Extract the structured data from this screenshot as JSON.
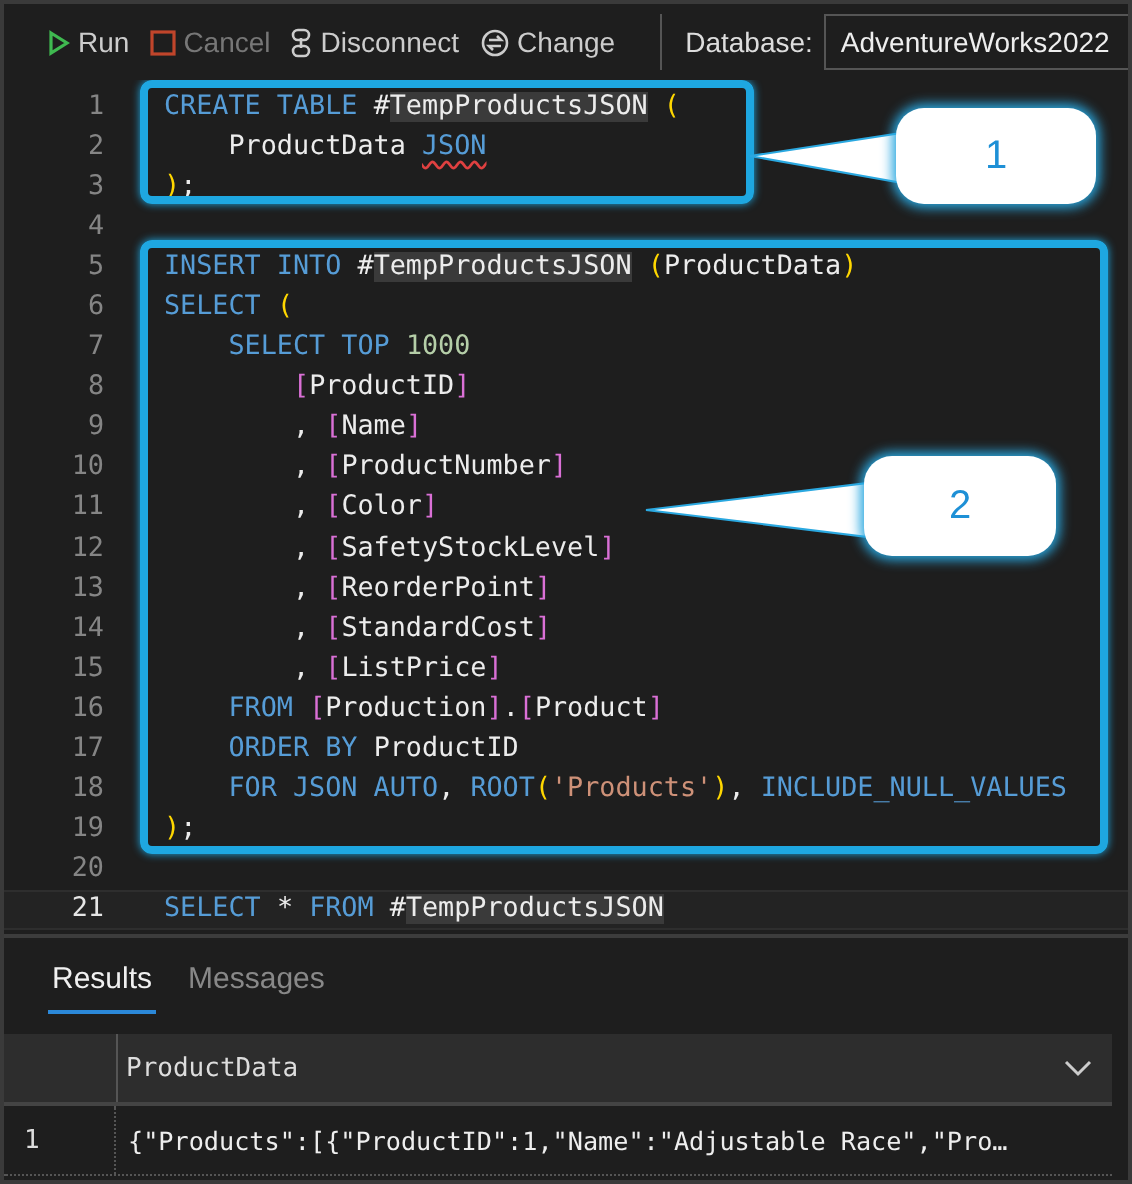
{
  "toolbar": {
    "buttons": [
      {
        "kind": "run",
        "label": "Run",
        "disabled": false
      },
      {
        "kind": "cancel",
        "label": "Cancel",
        "disabled": true
      },
      {
        "kind": "disconnect",
        "label": "Disconnect",
        "disabled": false
      },
      {
        "kind": "change",
        "label": "Change",
        "disabled": false
      }
    ],
    "database_label": "Database:",
    "database": "AdventureWorks2022"
  },
  "editor": {
    "lines": [
      {
        "number": "1",
        "current": false,
        "tokens": [
          {
            "kind": "kw",
            "text": "CREATE TABLE "
          },
          {
            "kind": "plain",
            "text": "#"
          },
          {
            "kind": "hl",
            "text": "TempProductsJSON"
          },
          {
            "kind": "paren",
            "text": " ("
          }
        ]
      },
      {
        "number": "2",
        "current": false,
        "tokens": [
          {
            "kind": "plain",
            "text": "    ProductData "
          },
          {
            "kind": "err",
            "text": "JSON"
          }
        ]
      },
      {
        "number": "3",
        "current": false,
        "tokens": [
          {
            "kind": "paren",
            "text": ")"
          },
          {
            "kind": "plain",
            "text": ";"
          }
        ]
      },
      {
        "number": "4",
        "current": false
      },
      {
        "number": "5",
        "current": false,
        "tokens": [
          {
            "kind": "kw",
            "text": "INSERT INTO "
          },
          {
            "kind": "plain",
            "text": "#"
          },
          {
            "kind": "hl",
            "text": "TempProductsJSON"
          },
          {
            "kind": "paren",
            "text": " ("
          },
          {
            "kind": "plain",
            "text": "ProductData"
          },
          {
            "kind": "paren",
            "text": ")"
          }
        ]
      },
      {
        "number": "6",
        "current": false,
        "tokens": [
          {
            "kind": "kw",
            "text": "SELECT "
          },
          {
            "kind": "paren",
            "text": "("
          }
        ]
      },
      {
        "number": "7",
        "current": false,
        "tokens": [
          {
            "kind": "kw",
            "text": "    SELECT TOP "
          },
          {
            "kind": "num",
            "text": "1000"
          }
        ]
      },
      {
        "number": "8",
        "current": false,
        "tokens": [
          {
            "kind": "br",
            "text": "        ["
          },
          {
            "kind": "plain",
            "text": "ProductID"
          },
          {
            "kind": "br",
            "text": "]"
          }
        ]
      },
      {
        "number": "9",
        "current": false,
        "tokens": [
          {
            "kind": "plain",
            "text": "        , "
          },
          {
            "kind": "br",
            "text": "["
          },
          {
            "kind": "plain",
            "text": "Name"
          },
          {
            "kind": "br",
            "text": "]"
          }
        ]
      },
      {
        "number": "10",
        "current": false,
        "tokens": [
          {
            "kind": "plain",
            "text": "        , "
          },
          {
            "kind": "br",
            "text": "["
          },
          {
            "kind": "plain",
            "text": "ProductNumber"
          },
          {
            "kind": "br",
            "text": "]"
          }
        ]
      },
      {
        "number": "11",
        "current": false,
        "tokens": [
          {
            "kind": "plain",
            "text": "        , "
          },
          {
            "kind": "br",
            "text": "["
          },
          {
            "kind": "plain",
            "text": "Color"
          },
          {
            "kind": "br",
            "text": "]"
          }
        ]
      },
      {
        "number": "12",
        "current": false,
        "tokens": [
          {
            "kind": "plain",
            "text": "        , "
          },
          {
            "kind": "br",
            "text": "["
          },
          {
            "kind": "plain",
            "text": "SafetyStockLevel"
          },
          {
            "kind": "br",
            "text": "]"
          }
        ]
      },
      {
        "number": "13",
        "current": false,
        "tokens": [
          {
            "kind": "plain",
            "text": "        , "
          },
          {
            "kind": "br",
            "text": "["
          },
          {
            "kind": "plain",
            "text": "ReorderPoint"
          },
          {
            "kind": "br",
            "text": "]"
          }
        ]
      },
      {
        "number": "14",
        "current": false,
        "tokens": [
          {
            "kind": "plain",
            "text": "        , "
          },
          {
            "kind": "br",
            "text": "["
          },
          {
            "kind": "plain",
            "text": "StandardCost"
          },
          {
            "kind": "br",
            "text": "]"
          }
        ]
      },
      {
        "number": "15",
        "current": false,
        "tokens": [
          {
            "kind": "plain",
            "text": "        , "
          },
          {
            "kind": "br",
            "text": "["
          },
          {
            "kind": "plain",
            "text": "ListPrice"
          },
          {
            "kind": "br",
            "text": "]"
          }
        ]
      },
      {
        "number": "16",
        "current": false,
        "tokens": [
          {
            "kind": "kw",
            "text": "    FROM "
          },
          {
            "kind": "br",
            "text": "["
          },
          {
            "kind": "plain",
            "text": "Production"
          },
          {
            "kind": "br",
            "text": "]"
          },
          {
            "kind": "plain",
            "text": "."
          },
          {
            "kind": "br",
            "text": "["
          },
          {
            "kind": "plain",
            "text": "Product"
          },
          {
            "kind": "br",
            "text": "]"
          }
        ]
      },
      {
        "number": "17",
        "current": false,
        "tokens": [
          {
            "kind": "kw",
            "text": "    ORDER BY "
          },
          {
            "kind": "plain",
            "text": "ProductID"
          }
        ]
      },
      {
        "number": "18",
        "current": false,
        "tokens": [
          {
            "kind": "kw",
            "text": "    FOR JSON AUTO"
          },
          {
            "kind": "plain",
            "text": ", "
          },
          {
            "kind": "kw",
            "text": "ROOT"
          },
          {
            "kind": "paren",
            "text": "("
          },
          {
            "kind": "str",
            "text": "'Products'"
          },
          {
            "kind": "paren",
            "text": ")"
          },
          {
            "kind": "plain",
            "text": ", "
          },
          {
            "kind": "kw",
            "text": "INCLUDE_NULL_VALUES"
          }
        ]
      },
      {
        "number": "19",
        "current": false,
        "tokens": [
          {
            "kind": "paren",
            "text": ")"
          },
          {
            "kind": "plain",
            "text": ";"
          }
        ]
      },
      {
        "number": "20",
        "current": false
      },
      {
        "number": "21",
        "current": true,
        "tokens": [
          {
            "kind": "kw",
            "text": "SELECT "
          },
          {
            "kind": "plain",
            "text": "* "
          },
          {
            "kind": "kw",
            "text": "FROM "
          },
          {
            "kind": "plain",
            "text": "#"
          },
          {
            "kind": "hl",
            "text": "TempProductsJSON"
          }
        ]
      }
    ],
    "callouts": [
      {
        "label": "1"
      },
      {
        "label": "2"
      }
    ]
  },
  "results": {
    "tabs": [
      {
        "label": "Results",
        "selected": true
      },
      {
        "label": "Messages",
        "selected": false
      }
    ],
    "columns": [
      "ProductData"
    ],
    "rows": [
      {
        "number": "1",
        "cells": [
          "{\"Products\":[{\"ProductID\":1,\"Name\":\"Adjustable Race\",\"Pro…"
        ]
      }
    ]
  }
}
